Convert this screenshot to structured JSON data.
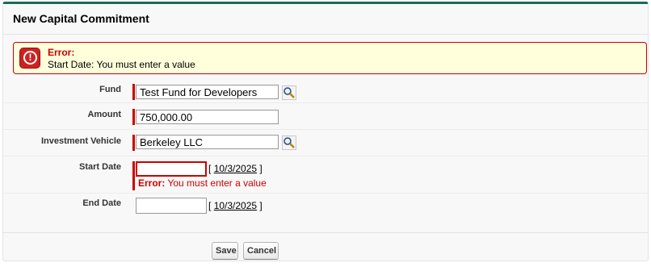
{
  "header": {
    "title": "New Capital Commitment"
  },
  "page_error": {
    "title": "Error:",
    "message": "Start Date: You must enter a value"
  },
  "fields": {
    "fund": {
      "label": "Fund",
      "value": "Test Fund for Developers",
      "icon": "lookup-icon"
    },
    "amount": {
      "label": "Amount",
      "value": "750,000.00"
    },
    "investment_vehicle": {
      "label": "Investment Vehicle",
      "value": "Berkeley LLC",
      "icon": "lookup-icon"
    },
    "start_date": {
      "label": "Start Date",
      "value": "",
      "today_link": "10/3/2025",
      "bracket_open": "[",
      "bracket_close": "]",
      "error_label": "Error:",
      "error_text": "You must enter a value"
    },
    "end_date": {
      "label": "End Date",
      "value": "",
      "today_link": "10/3/2025",
      "bracket_open": "[",
      "bracket_close": "]"
    }
  },
  "buttons": {
    "save": "Save",
    "cancel": "Cancel"
  },
  "colors": {
    "accent_border": "#1c6b5a",
    "required": "#cc0000",
    "error_bg": "#ffffdc"
  }
}
